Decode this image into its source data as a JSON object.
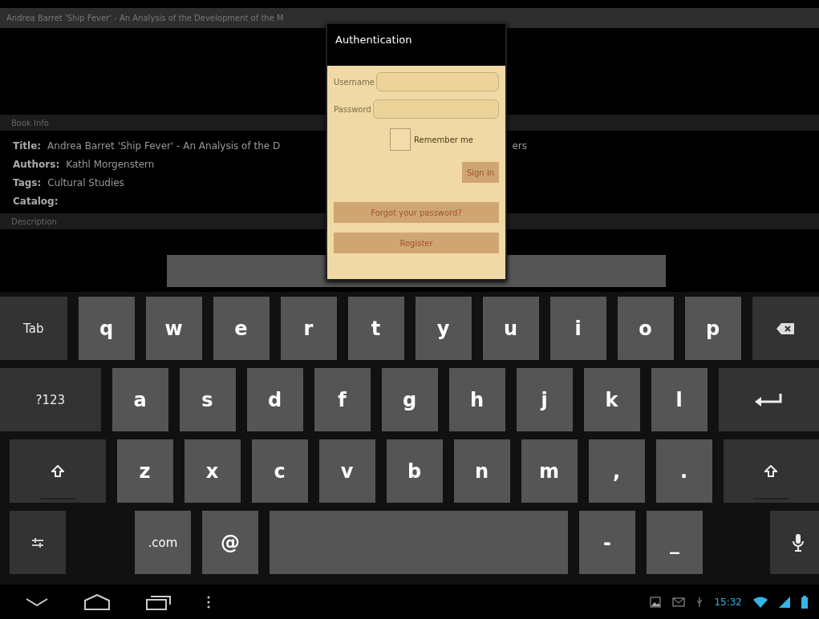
{
  "header": {
    "title": "Andrea Barret 'Ship Fever' - An Analysis of the Development of the M"
  },
  "book_info": {
    "section_label": "Book Info",
    "fields": [
      {
        "label": "Title:",
        "value": "Andrea Barret 'Ship Fever' - An Analysis of the D",
        "value_tail": "ers"
      },
      {
        "label": "Authors:",
        "value": "Kathl Morgenstern"
      },
      {
        "label": "Tags:",
        "value": "Cultural Studies"
      },
      {
        "label": "Catalog:"
      }
    ]
  },
  "description": {
    "section_label": "Description"
  },
  "dialog": {
    "title": "Authentication",
    "username_label": "Username",
    "password_label": "Password",
    "remember": {
      "label": "Remember me",
      "checked": false
    },
    "sign_in": "Sign in",
    "forgot": "Forgot your password?",
    "register": "Register"
  },
  "keyboard": {
    "rows": [
      [
        {
          "kind": "fn-text",
          "label": "Tab"
        },
        {
          "kind": "text",
          "label": "q"
        },
        {
          "kind": "text",
          "label": "w"
        },
        {
          "kind": "text",
          "label": "e"
        },
        {
          "kind": "text",
          "label": "r"
        },
        {
          "kind": "text",
          "label": "t"
        },
        {
          "kind": "text",
          "label": "y"
        },
        {
          "kind": "text",
          "label": "u"
        },
        {
          "kind": "text",
          "label": "i"
        },
        {
          "kind": "text",
          "label": "o"
        },
        {
          "kind": "text",
          "label": "p"
        },
        {
          "kind": "backspace"
        }
      ],
      [
        {
          "kind": "fn-text",
          "label": "?123"
        },
        {
          "kind": "text",
          "label": "a"
        },
        {
          "kind": "text",
          "label": "s"
        },
        {
          "kind": "text",
          "label": "d"
        },
        {
          "kind": "text",
          "label": "f"
        },
        {
          "kind": "text",
          "label": "g"
        },
        {
          "kind": "text",
          "label": "h"
        },
        {
          "kind": "text",
          "label": "j"
        },
        {
          "kind": "text",
          "label": "k"
        },
        {
          "kind": "text",
          "label": "l"
        },
        {
          "kind": "enter"
        }
      ],
      [
        {
          "kind": "shift"
        },
        {
          "kind": "text",
          "label": "z"
        },
        {
          "kind": "text",
          "label": "x"
        },
        {
          "kind": "text",
          "label": "c"
        },
        {
          "kind": "text",
          "label": "v"
        },
        {
          "kind": "text",
          "label": "b"
        },
        {
          "kind": "text",
          "label": "n"
        },
        {
          "kind": "text",
          "label": "m"
        },
        {
          "kind": "text",
          "label": ","
        },
        {
          "kind": "text",
          "label": "."
        },
        {
          "kind": "shift"
        }
      ],
      [
        {
          "kind": "settings"
        },
        {
          "kind": "small-text",
          "label": ".com"
        },
        {
          "kind": "text",
          "label": "@"
        },
        {
          "kind": "space"
        },
        {
          "kind": "text",
          "label": "-"
        },
        {
          "kind": "text",
          "label": "_"
        },
        {
          "kind": "mic"
        }
      ]
    ]
  },
  "status_bar": {
    "time": "15:32"
  }
}
